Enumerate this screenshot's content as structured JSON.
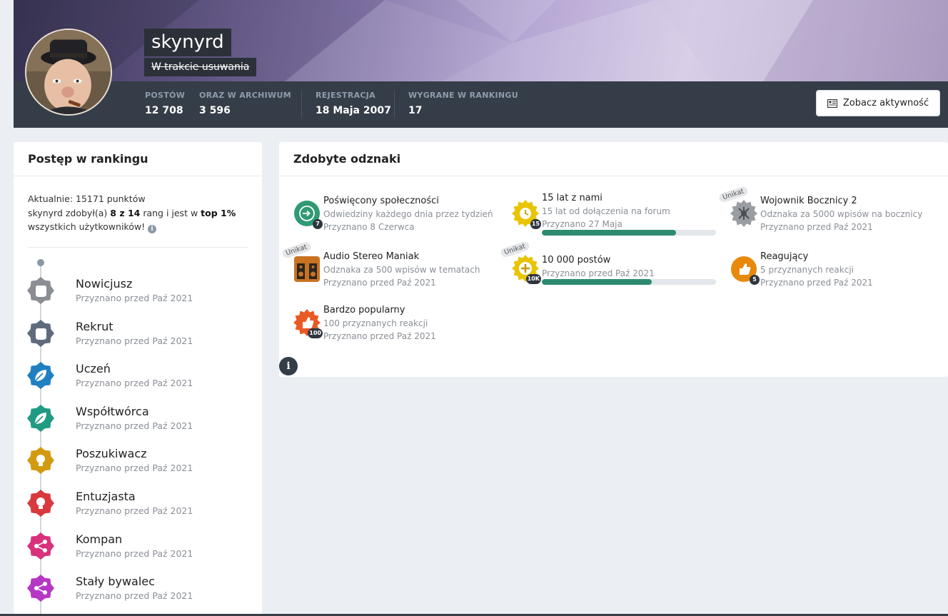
{
  "profile": {
    "username": "skynyrd",
    "status": "W trakcie usuwania",
    "activity_button": "Zobacz aktywność",
    "stats": [
      {
        "label": "POSTÓW",
        "value": "12 708"
      },
      {
        "label": "ORAZ W ARCHIWUM",
        "value": "3 596"
      },
      {
        "label": "REJESTRACJA",
        "value": "18 Maja 2007"
      },
      {
        "label": "WYGRANE W RANKINGU",
        "value": "17"
      }
    ]
  },
  "ranking": {
    "title": "Postęp w rankingu",
    "current_prefix": "Aktualnie: ",
    "current_points": "15171 punktów",
    "line2_user": "skynyrd zdobył(a) ",
    "line2_ranks": "8 z 14",
    "line2_mid": " rang i jest w ",
    "line2_top": "top 1%",
    "line3": "wszystkich użytkowników!",
    "info_icon": "i",
    "ranks": [
      {
        "name": "Nowicjusz",
        "awarded": "Przyznano przed Paź 2021",
        "color": "#8a8d92",
        "icon": "hand-icon"
      },
      {
        "name": "Rekrut",
        "awarded": "Przyznano przed Paź 2021",
        "color": "#5f6b7c",
        "icon": "hand-icon"
      },
      {
        "name": "Uczeń",
        "awarded": "Przyznano przed Paź 2021",
        "color": "#1f7fc0",
        "icon": "leaf-icon"
      },
      {
        "name": "Współtwórca",
        "awarded": "Przyznano przed Paź 2021",
        "color": "#1f9a83",
        "icon": "leaf-icon"
      },
      {
        "name": "Poszukiwacz",
        "awarded": "Przyznano przed Paź 2021",
        "color": "#d29a0f",
        "icon": "bulb-icon"
      },
      {
        "name": "Entuzjasta",
        "awarded": "Przyznano przed Paź 2021",
        "color": "#d8393f",
        "icon": "bulb-icon"
      },
      {
        "name": "Kompan",
        "awarded": "Przyznano przed Paź 2021",
        "color": "#d9327c",
        "icon": "share-icon"
      },
      {
        "name": "Stały bywalec",
        "awarded": "Przyznano przed Paź 2021",
        "color": "#b637c4",
        "icon": "share-icon"
      }
    ]
  },
  "badges": {
    "title": "Zdobyte odznaki",
    "unique_label": "Unikat",
    "info_label": "i",
    "items": [
      {
        "name": "Poświęcony społeczności",
        "description": "Odwiedziny każdego dnia przez tydzień",
        "awarded": "Przyznano 8 Czerwca",
        "count": "7",
        "icon": "signin-icon"
      },
      {
        "name": "15 lat z nami",
        "description": "15 lat od dołączenia na forum",
        "awarded": "Przyznano 27 Maja",
        "count": "15",
        "icon": "clock-icon",
        "progress": 0.77
      },
      {
        "name": "Wojownik Bocznicy 2",
        "description": "Odznaka za 5000 wpisów na bocznicy",
        "awarded": "Przyznano przed Paź 2021",
        "icon": "insect-icon",
        "unique": true
      },
      {
        "name": "Audio Stereo Maniak",
        "description": "Odznaka za 500 wpisów w tematach",
        "awarded": "Przyznano przed Paź 2021",
        "icon": "speakers-icon",
        "unique": true
      },
      {
        "name": "10 000 postów",
        "awarded": "Przyznano przed Paź 2021",
        "count": "10K",
        "icon": "plus-icon",
        "unique": true,
        "progress": 0.63
      },
      {
        "name": "Reagujący",
        "description": "5 przyznanych reakcji",
        "awarded": "Przyznano przed Paź 2021",
        "count": "5",
        "icon": "thumb-icon"
      },
      {
        "name": "Bardzo popularny",
        "description": "100 przyznanych reakcji",
        "awarded": "Przyznano przed Paź 2021",
        "count": "100",
        "icon": "thumb-icon"
      }
    ]
  }
}
